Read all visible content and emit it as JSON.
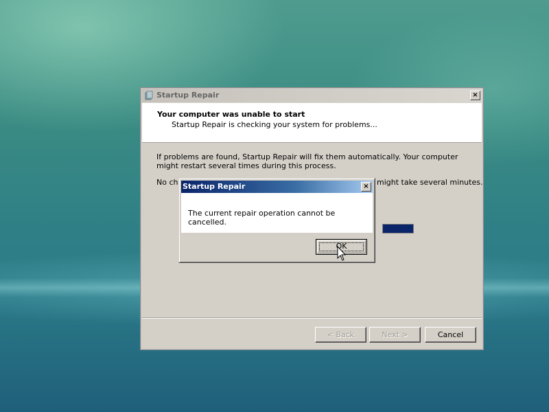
{
  "main_window": {
    "title": "Startup Repair",
    "close_label": "×",
    "header_title": "Your computer was unable to start",
    "header_subtitle": "Startup Repair is checking your system for problems...",
    "body_line1": "If problems are found, Startup Repair will fix them automatically. Your computer might restart several times during this process.",
    "body_line2_visible_left": "No cha",
    "body_line2_visible_right": "might take several minutes.",
    "progress": 1.0,
    "buttons": {
      "back": "< Back",
      "next": "Next >",
      "cancel": "Cancel"
    }
  },
  "dialog": {
    "title": "Startup Repair",
    "close_label": "×",
    "message": "The current repair operation cannot be cancelled.",
    "ok_label": "OK"
  },
  "colors": {
    "title_active": "#0a246a",
    "progress_fill": "#0a246a",
    "window_face": "#d4d0c8"
  },
  "icons": [
    "startup-repair-app-icon",
    "close-icon",
    "mouse-pointer-icon"
  ]
}
